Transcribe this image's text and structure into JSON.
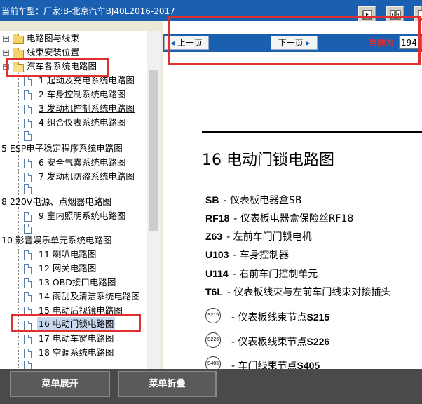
{
  "title_bar": {
    "model_label": "当前车型：",
    "manufacturer": "厂家:B-北京汽车BJ40L2016-2017"
  },
  "tree": {
    "folders": [
      {
        "label": "电路图与线束"
      },
      {
        "label": "线束安装位置"
      },
      {
        "label": "汽车各系统电路图"
      }
    ],
    "items": [
      {
        "label": "1  起动及充电系统电路图"
      },
      {
        "label": "2  车身控制系统电路图"
      },
      {
        "label": "3  发动机控制系统电路图"
      },
      {
        "label": "4  组合仪表系统电路图"
      },
      {
        "label": ""
      },
      {
        "label": "5  ESP电子稳定程序系统电路图"
      },
      {
        "label": "6  安全气囊系统电路图"
      },
      {
        "label": "7  发动机防盗系统电路图"
      },
      {
        "label": ""
      },
      {
        "label": "8  220V电源、点烟器电路图"
      },
      {
        "label": "9  室内照明系统电路图"
      },
      {
        "label": ""
      },
      {
        "label": "10  影音娱乐单元系统电路图"
      },
      {
        "label": "11  喇叭电路图"
      },
      {
        "label": "12  网关电路图"
      },
      {
        "label": "13  OBD接口电路图"
      },
      {
        "label": "14  雨刮及清洁系统电路图"
      },
      {
        "label": "15  电动后视镜电路图"
      },
      {
        "label": "16  电动门锁电路图"
      },
      {
        "label": "17  电动车窗电路图"
      },
      {
        "label": "18  空调系统电路图"
      },
      {
        "label": ""
      }
    ]
  },
  "nav": {
    "prev_label": "上一页",
    "next_label": "下一页",
    "current_label": "当前为",
    "current_page": "194"
  },
  "document": {
    "title": "16 电动门锁电路图",
    "components": [
      {
        "code": "SB",
        "desc": "- 仪表板电器盒SB"
      },
      {
        "code": "RF18",
        "desc": "- 仪表板电器盒保险丝RF18"
      },
      {
        "code": "Z63",
        "desc": "- 左前车门门锁电机"
      },
      {
        "code": "U103",
        "desc": "- 车身控制器"
      },
      {
        "code": "U114",
        "desc": "- 右前车门控制单元"
      },
      {
        "code": "T6L",
        "desc": "- 仪表板线束与左前车门线束对接插头"
      }
    ],
    "nodes": [
      {
        "symbol": "S215",
        "desc": "-  仪表板线束节点",
        "code": "S215"
      },
      {
        "symbol": "S226",
        "desc": "-  仪表板线束节点",
        "code": "S226"
      },
      {
        "symbol": "S405",
        "desc": "-  车门线束节点",
        "code": "S405"
      }
    ]
  },
  "bottom": {
    "expand_label": "菜单展开",
    "collapse_label": "菜单折叠"
  },
  "colors": {
    "title_bar": "#1a5fb0",
    "annotation": "#e03030",
    "bottom_bar": "#4a4a4a"
  }
}
